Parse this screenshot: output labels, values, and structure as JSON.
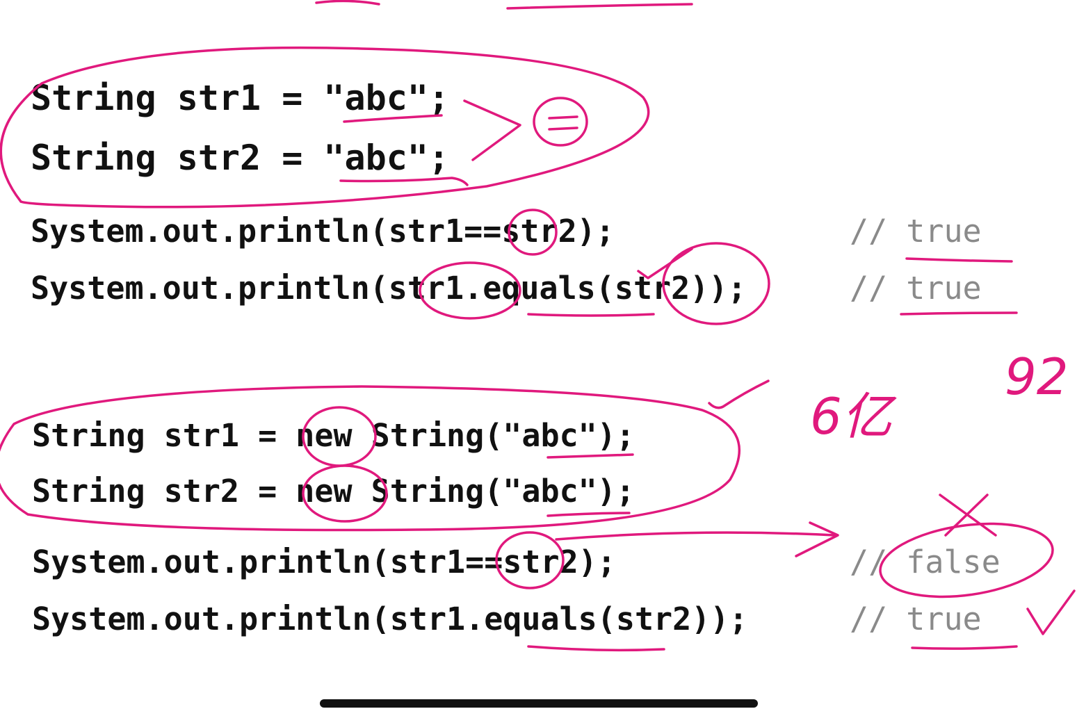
{
  "block1": {
    "line1": "String str1 = \"abc\";",
    "line2": "String str2 = \"abc\";",
    "line3": "System.out.println(str1==str2);",
    "line4": "System.out.println(str1.equals(str2));",
    "comment3": "// true",
    "comment4": "// true"
  },
  "block2": {
    "line1": "String str1 = new String(\"abc\");",
    "line2": "String str2 = new String(\"abc\");",
    "line3": "System.out.println(str1==str2);",
    "line4": "System.out.println(str1.equals(str2));",
    "comment3": "// false",
    "comment4": "// true"
  },
  "annotations": {
    "equals_mark": "=",
    "note_left": "6亿",
    "note_right": "92",
    "color": "#e0197d"
  },
  "icons": {
    "home_indicator": "home-indicator-bar"
  }
}
